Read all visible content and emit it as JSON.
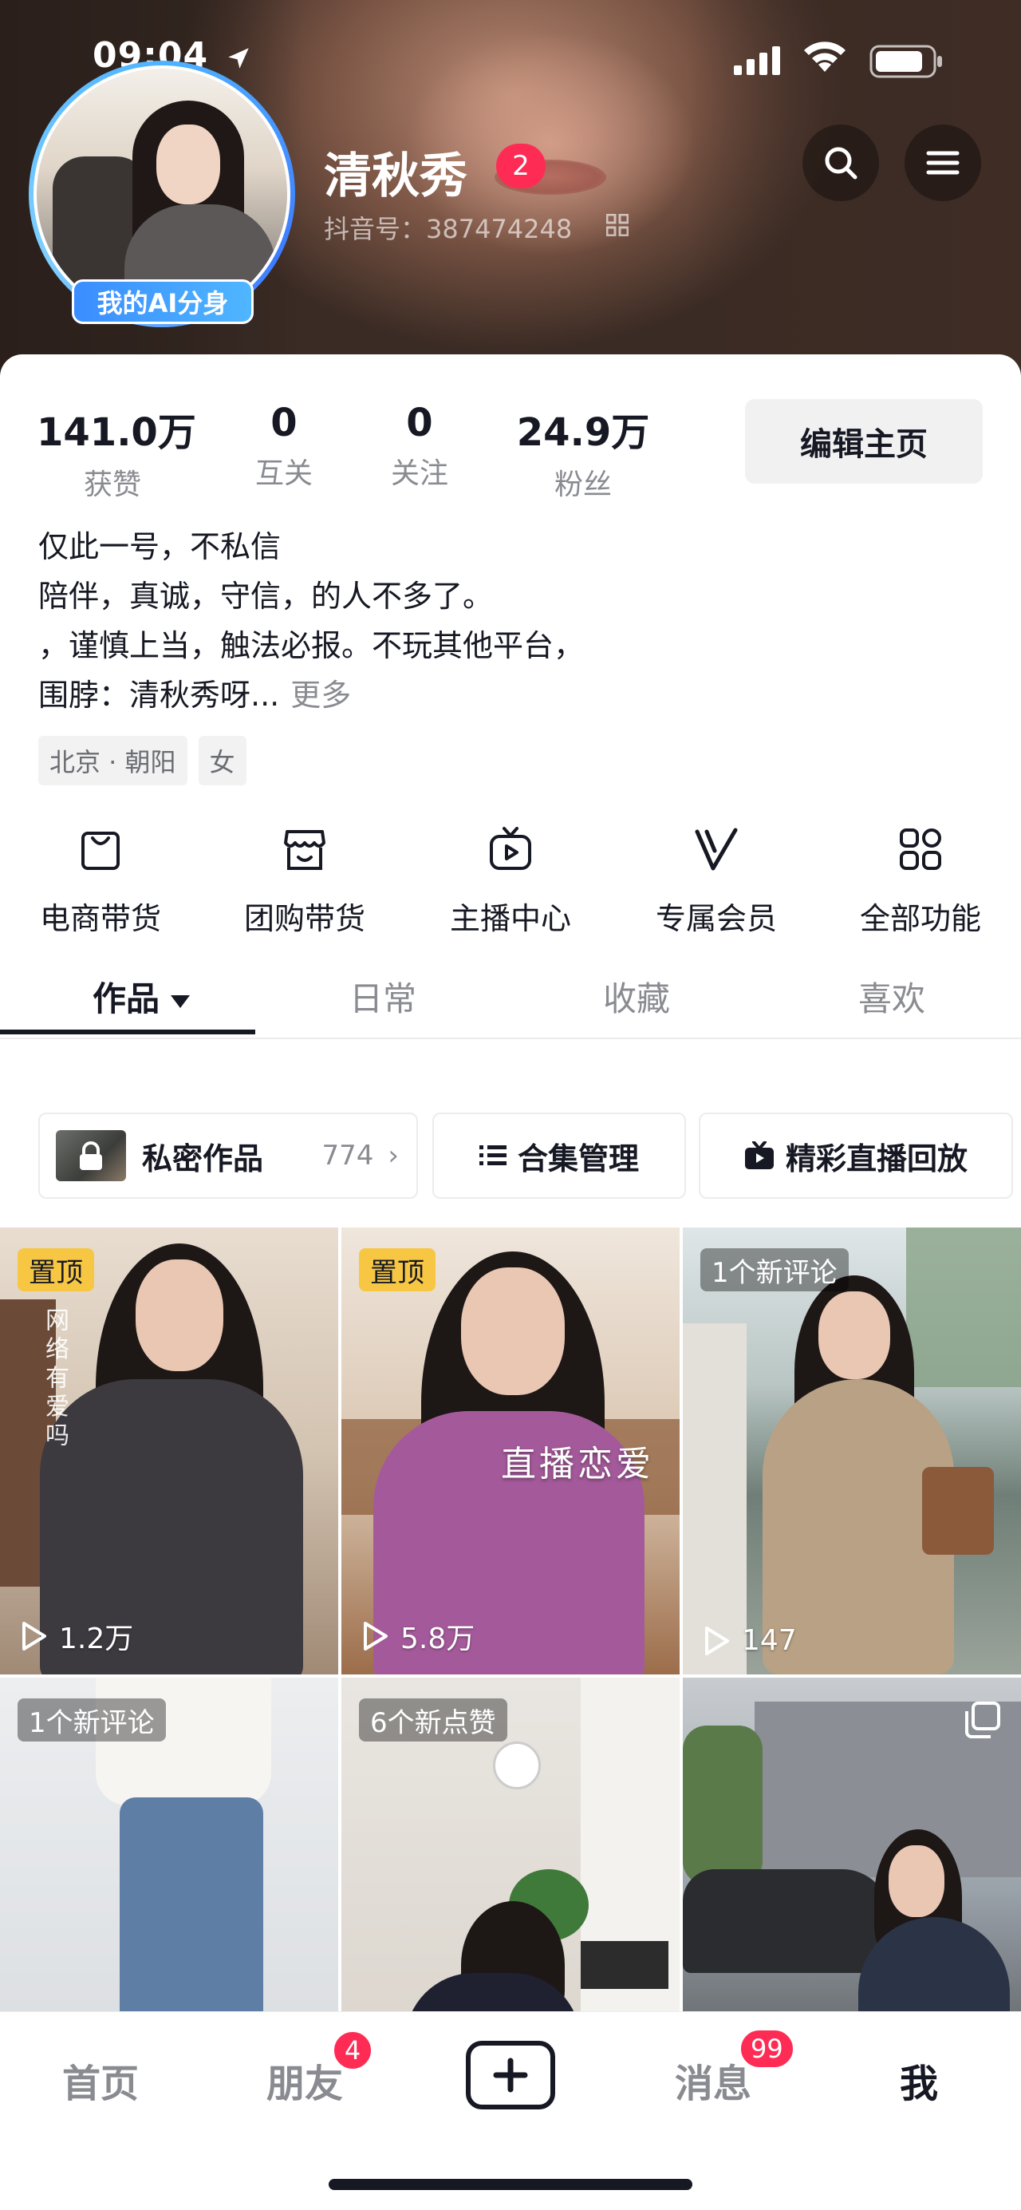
{
  "status_bar": {
    "time": "09:04"
  },
  "profile": {
    "nickname": "清秋秀",
    "notification_count": "2",
    "douyin_id": "抖音号：387474248",
    "avatar_badge": "我的AI分身"
  },
  "header_buttons": {
    "search_icon": "search-icon",
    "menu_icon": "menu-icon"
  },
  "stats": [
    {
      "value": "141.0万",
      "label": "获赞"
    },
    {
      "value": "0",
      "label": "互关"
    },
    {
      "value": "0",
      "label": "关注"
    },
    {
      "value": "24.9万",
      "label": "粉丝"
    }
  ],
  "edit_profile_label": "编辑主页",
  "bio": {
    "lines": [
      "仅此一号，不私信",
      "陪伴，真诚，守信，的人不多了。",
      "，谨慎上当，触法必报。不玩其他平台，",
      "围脖：清秋秀呀..."
    ],
    "more_label": "更多"
  },
  "tags": [
    "北京 · 朝阳",
    "女"
  ],
  "features": [
    {
      "label": "电商带货",
      "icon": "shopping-bag-icon"
    },
    {
      "label": "团购带货",
      "icon": "store-icon"
    },
    {
      "label": "主播中心",
      "icon": "tv-play-icon"
    },
    {
      "label": "专属会员",
      "icon": "vip-v-icon"
    },
    {
      "label": "全部功能",
      "icon": "grid-apps-icon"
    }
  ],
  "tabs": [
    {
      "label": "作品",
      "active": true
    },
    {
      "label": "日常",
      "active": false
    },
    {
      "label": "收藏",
      "active": false
    },
    {
      "label": "喜欢",
      "active": false
    }
  ],
  "sub_actions": {
    "private": {
      "label": "私密作品",
      "count": "774",
      "chevron": "›"
    },
    "collection": {
      "label": "合集管理"
    },
    "replay": {
      "label": "精彩直播回放"
    }
  },
  "videos": [
    {
      "badge": "置顶",
      "badge_type": "pin",
      "plays": "1.2万",
      "overlay_text": "网络有爱吗"
    },
    {
      "badge": "置顶",
      "badge_type": "pin",
      "plays": "5.8万",
      "overlay_text": "直播恋爱"
    },
    {
      "badge": "1个新评论",
      "badge_type": "note",
      "plays": "147"
    },
    {
      "badge": "1个新评论",
      "badge_type": "note"
    },
    {
      "badge": "6个新点赞",
      "badge_type": "note"
    },
    {
      "badge": "",
      "multi_image": true
    }
  ],
  "bottom_nav": [
    {
      "label": "首页",
      "active": false
    },
    {
      "label": "朋友",
      "badge": "4",
      "active": false
    },
    {
      "label": "+",
      "icon": "plus-icon"
    },
    {
      "label": "消息",
      "badge": "99",
      "active": false
    },
    {
      "label": "我",
      "active": true
    }
  ],
  "colors": {
    "accent": "#fe2c55",
    "pin_badge": "#f7c744",
    "ai_badge": "#3a8dff"
  }
}
